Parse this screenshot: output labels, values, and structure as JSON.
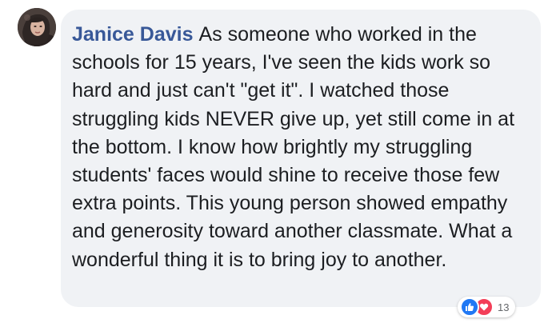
{
  "comment": {
    "author": "Janice Davis",
    "text": "As someone who worked in the schools for 15 years, I've seen the kids work so hard and just can't \"get it\". I watched those struggling kids NEVER give up, yet still come in at the bottom. I know how brightly my struggling students' faces would shine to receive those few extra points. This young person showed empathy and generosity toward another classmate. What a wonderful thing it is to bring joy to another.",
    "avatar_icon": "profile-photo",
    "reactions": {
      "icons": [
        "like-icon",
        "love-icon"
      ],
      "count": "13",
      "like_color": "#2078f4",
      "love_color": "#f33e58"
    }
  },
  "colors": {
    "bubble": "#f0f2f5",
    "author": "#385898",
    "text": "#1c1e21"
  }
}
